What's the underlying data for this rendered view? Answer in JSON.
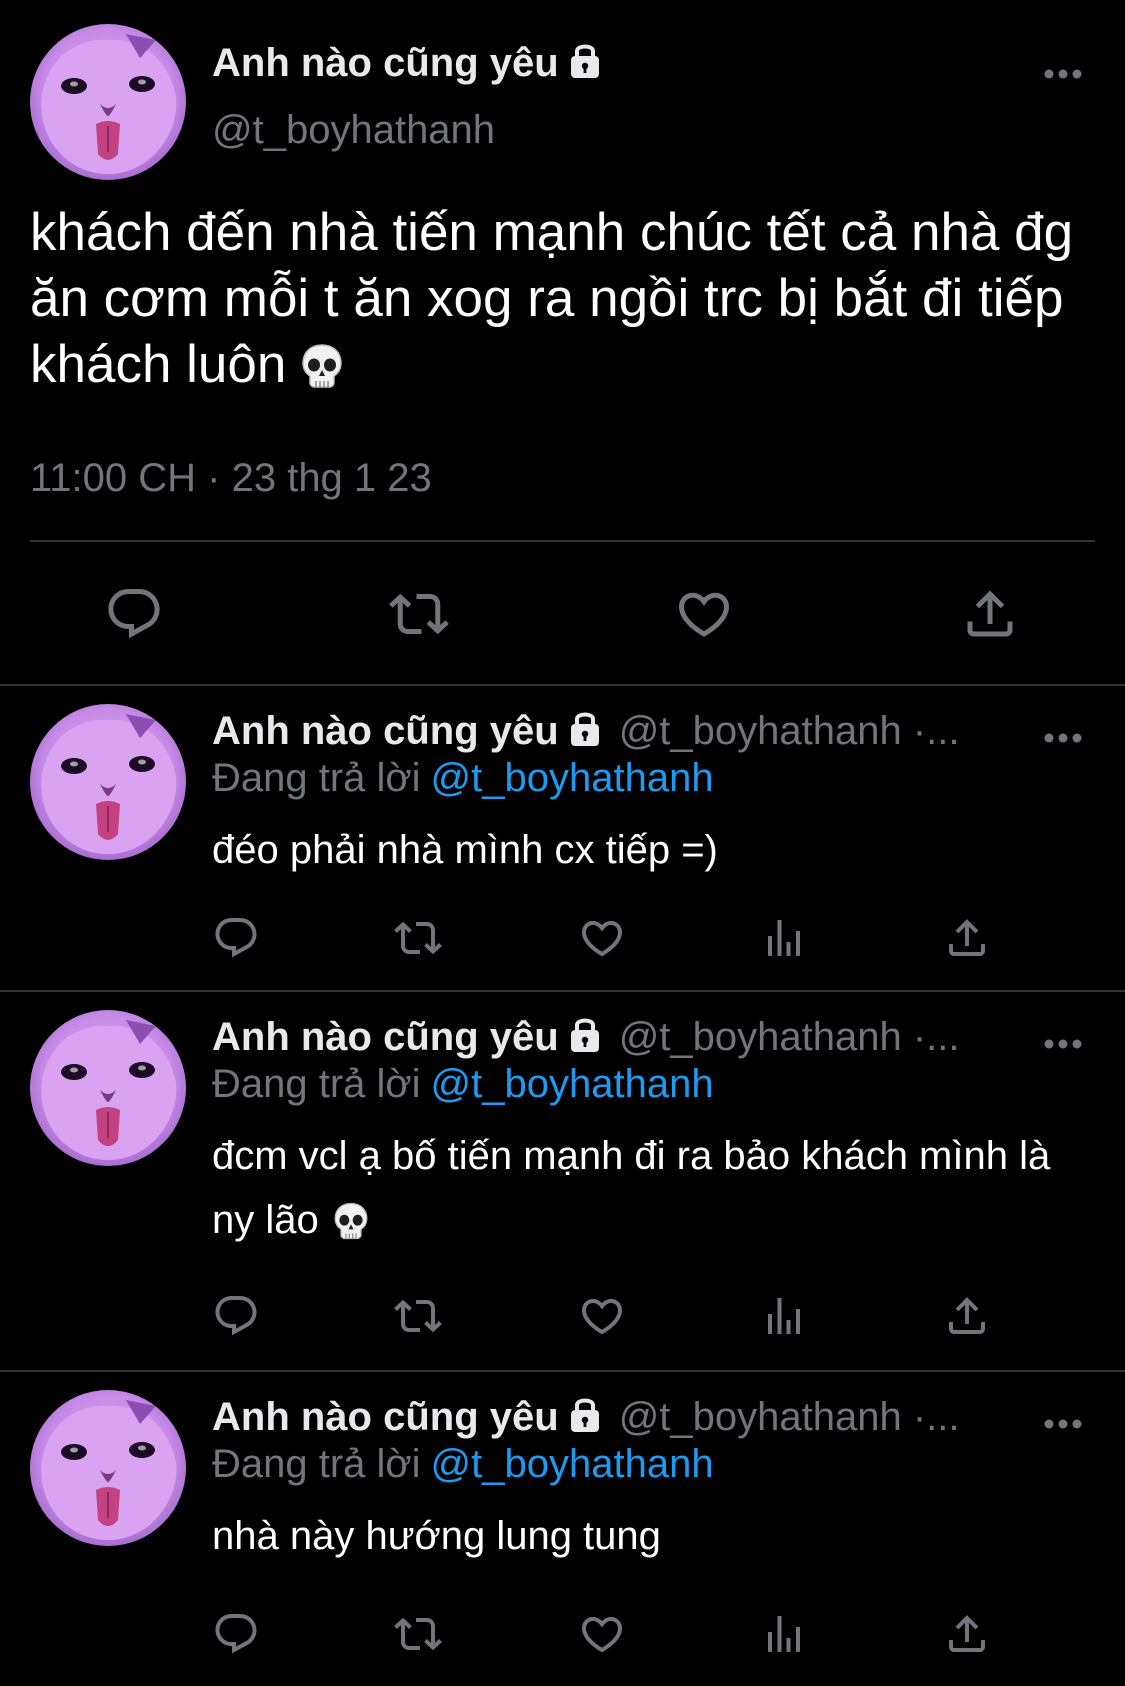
{
  "main_tweet": {
    "display_name": "Anh nào cũng yêu",
    "handle": "@t_boyhathanh",
    "text": "khách đến nhà tiến mạnh chúc tết cả nhà đg ăn cơm mỗi t ăn xog ra ngồi trc bị bắt đi tiếp khách luôn",
    "time": "11:00 CH",
    "separator": "·",
    "date": "23 thg 1 23",
    "icons": [
      "lock-icon",
      "more-icon",
      "skull-icon",
      "reply-icon",
      "retweet-icon",
      "like-icon",
      "share-icon"
    ]
  },
  "replies": [
    {
      "display_name": "Anh nào cũng yêu",
      "handle": "@t_boyhathanh ·...",
      "replying_label": "Đang trả lời",
      "replying_to": "@t_boyhathanh",
      "text": "đéo phải nhà mình cx tiếp =)"
    },
    {
      "display_name": "Anh nào cũng yêu",
      "handle": "@t_boyhathanh ·...",
      "replying_label": "Đang trả lời",
      "replying_to": "@t_boyhathanh",
      "text": "đcm vcl ạ bố tiến mạnh đi ra bảo khách mình là ny lão"
    },
    {
      "display_name": "Anh nào cũng yêu",
      "handle": "@t_boyhathanh ·...",
      "replying_label": "Đang trả lời",
      "replying_to": "@t_boyhathanh",
      "text": "nhà này hướng lung tung"
    }
  ],
  "colors": {
    "background": "#000000",
    "text_primary": "#e7e9ea",
    "text_secondary": "#71767b",
    "link": "#1d9bf0",
    "divider": "#2f3336",
    "avatar_tint": "#c78be8"
  }
}
